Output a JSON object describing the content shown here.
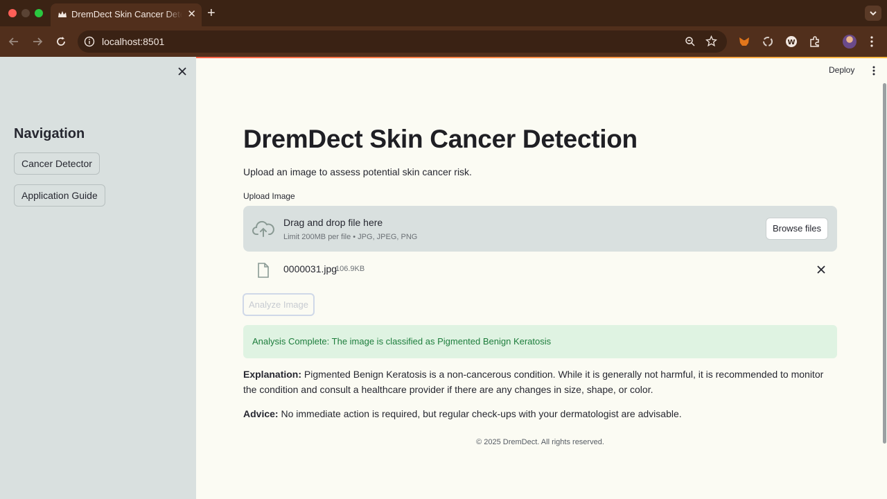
{
  "browser": {
    "tab_title": "DremDect Skin Cancer Detection",
    "url": "localhost:8501"
  },
  "sidebar": {
    "title": "Navigation",
    "buttons": [
      {
        "label": "Cancer Detector"
      },
      {
        "label": "Application Guide"
      }
    ]
  },
  "header": {
    "deploy_label": "Deploy"
  },
  "main": {
    "title": "DremDect Skin Cancer Detection",
    "subtitle": "Upload an image to assess potential skin cancer risk.",
    "uploader": {
      "label": "Upload Image",
      "drop_text": "Drag and drop file here",
      "limit_text": "Limit 200MB per file • JPG, JPEG, PNG",
      "browse_label": "Browse files",
      "file_name": "0000031.jpg",
      "file_size": "106.9KB"
    },
    "analyze_label": "Analyze Image",
    "result": "Analysis Complete: The image is classified as Pigmented Benign Keratosis",
    "explanation_label": "Explanation:",
    "explanation_text": " Pigmented Benign Keratosis is a non-cancerous condition. While it is generally not harmful, it is recommended to monitor the condition and consult a healthcare provider if there are any changes in size, shape, or color.",
    "advice_label": "Advice:",
    "advice_text": " No immediate action is required, but regular check-ups with your dermatologist are advisable.",
    "footer": "© 2025 DremDect. All rights reserved."
  },
  "colors": {
    "success_bg": "#dff3e2",
    "success_text": "#1d7d3c",
    "sidebar_bg": "#d9e0df",
    "page_bg": "#fbfbf3"
  }
}
